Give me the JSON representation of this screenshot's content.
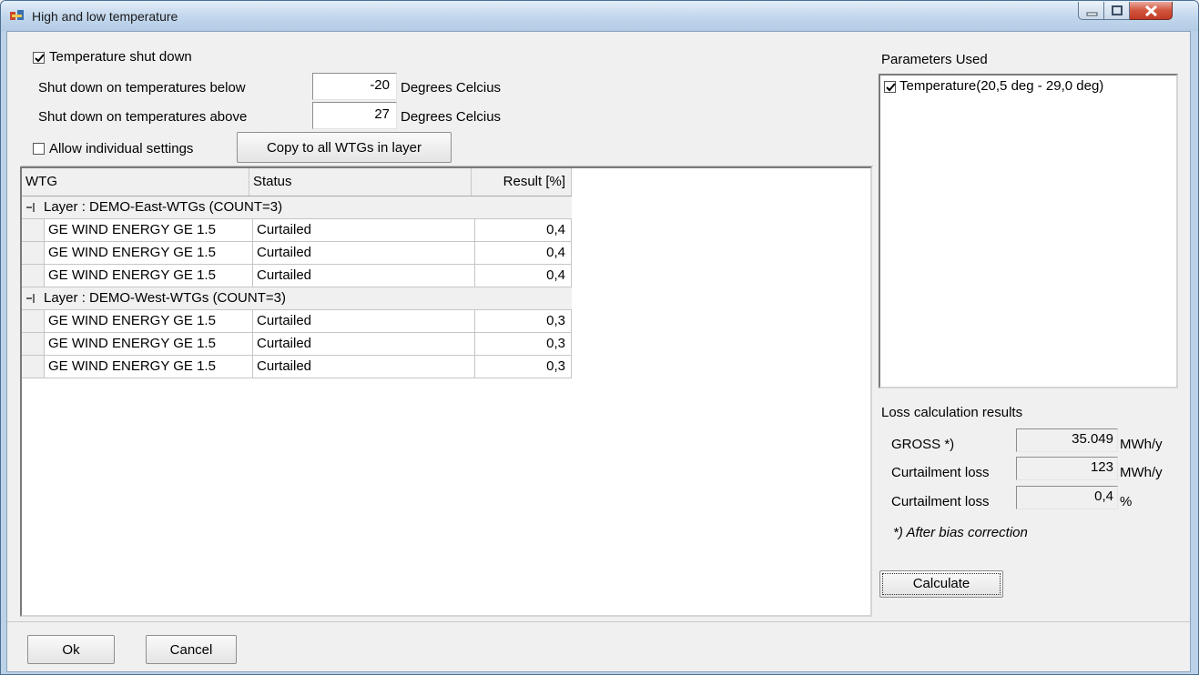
{
  "window": {
    "title": "High and low temperature"
  },
  "temperature": {
    "shutdown_label": "Temperature shut down",
    "shutdown_checked": true,
    "below_label": "Shut down on temperatures below",
    "below_value": "-20",
    "above_label": "Shut down on temperatures above",
    "above_value": "27",
    "unit": "Degrees Celcius"
  },
  "toolbar": {
    "individual_label": "Allow individual settings",
    "individual_checked": false,
    "copy_label": "Copy to all WTGs in layer"
  },
  "grid": {
    "columns": [
      "WTG",
      "Status",
      "Result [%]"
    ],
    "groups": [
      {
        "label": "Layer : DEMO-East-WTGs (COUNT=3)",
        "rows": [
          {
            "wtg": "GE WIND ENERGY GE 1.5",
            "status": "Curtailed",
            "result": "0,4"
          },
          {
            "wtg": "GE WIND ENERGY GE 1.5",
            "status": "Curtailed",
            "result": "0,4"
          },
          {
            "wtg": "GE WIND ENERGY GE 1.5",
            "status": "Curtailed",
            "result": "0,4"
          }
        ]
      },
      {
        "label": "Layer : DEMO-West-WTGs (COUNT=3)",
        "rows": [
          {
            "wtg": "GE WIND ENERGY GE 1.5",
            "status": "Curtailed",
            "result": "0,3"
          },
          {
            "wtg": "GE WIND ENERGY GE 1.5",
            "status": "Curtailed",
            "result": "0,3"
          },
          {
            "wtg": "GE WIND ENERGY GE 1.5",
            "status": "Curtailed",
            "result": "0,3"
          }
        ]
      }
    ]
  },
  "parameters": {
    "title": "Parameters Used",
    "items": [
      {
        "label": "Temperature(20,5 deg - 29,0 deg)",
        "checked": true
      }
    ]
  },
  "loss": {
    "title": "Loss calculation results",
    "rows": [
      {
        "label": "GROSS *)",
        "value": "35.049",
        "unit": "MWh/y"
      },
      {
        "label": "Curtailment loss",
        "value": "123",
        "unit": "MWh/y"
      },
      {
        "label": "Curtailment loss",
        "value": "0,4",
        "unit": "%"
      }
    ],
    "footnote": "*) After bias correction",
    "calculate_label": "Calculate"
  },
  "footer": {
    "ok_label": "Ok",
    "cancel_label": "Cancel"
  }
}
